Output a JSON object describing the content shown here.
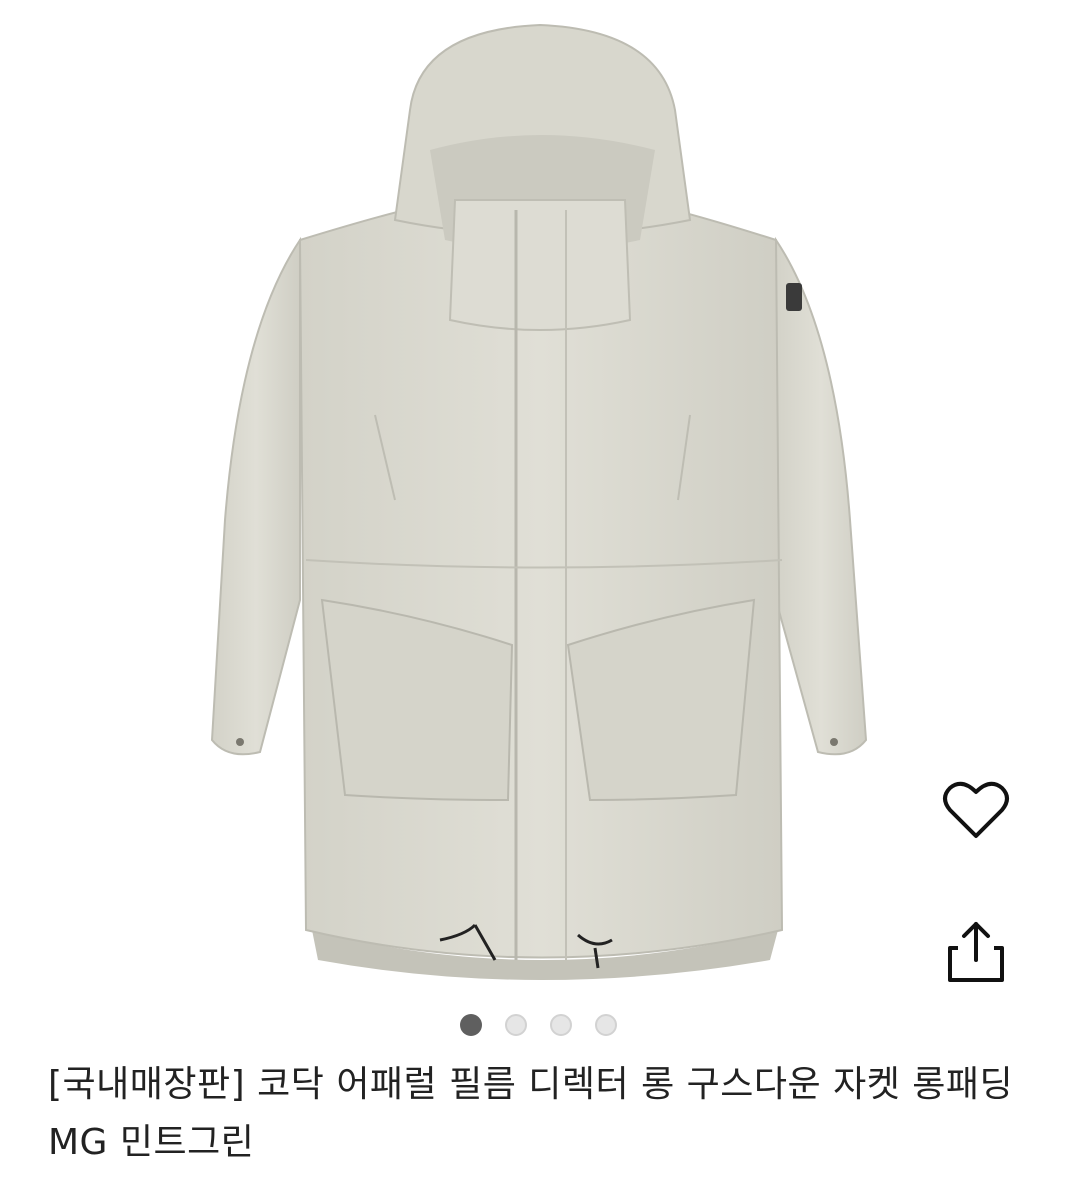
{
  "product": {
    "image_alt": "Kodak apparel long goose down jacket, mint green",
    "title": "[국내매장판] 코닥 어패럴 필름 디렉터 롱 구스다운 자켓 롱패딩 MG 민트그린"
  },
  "actions": {
    "like_icon": "heart-icon",
    "share_icon": "share-icon"
  },
  "carousel": {
    "total": 4,
    "active_index": 0
  },
  "colors": {
    "jacket": "#dcdbd2",
    "jacket_shadow": "#c9c8be",
    "text": "#222222",
    "dot_active": "#5f5f5f",
    "dot_inactive": "#e6e6e6"
  }
}
